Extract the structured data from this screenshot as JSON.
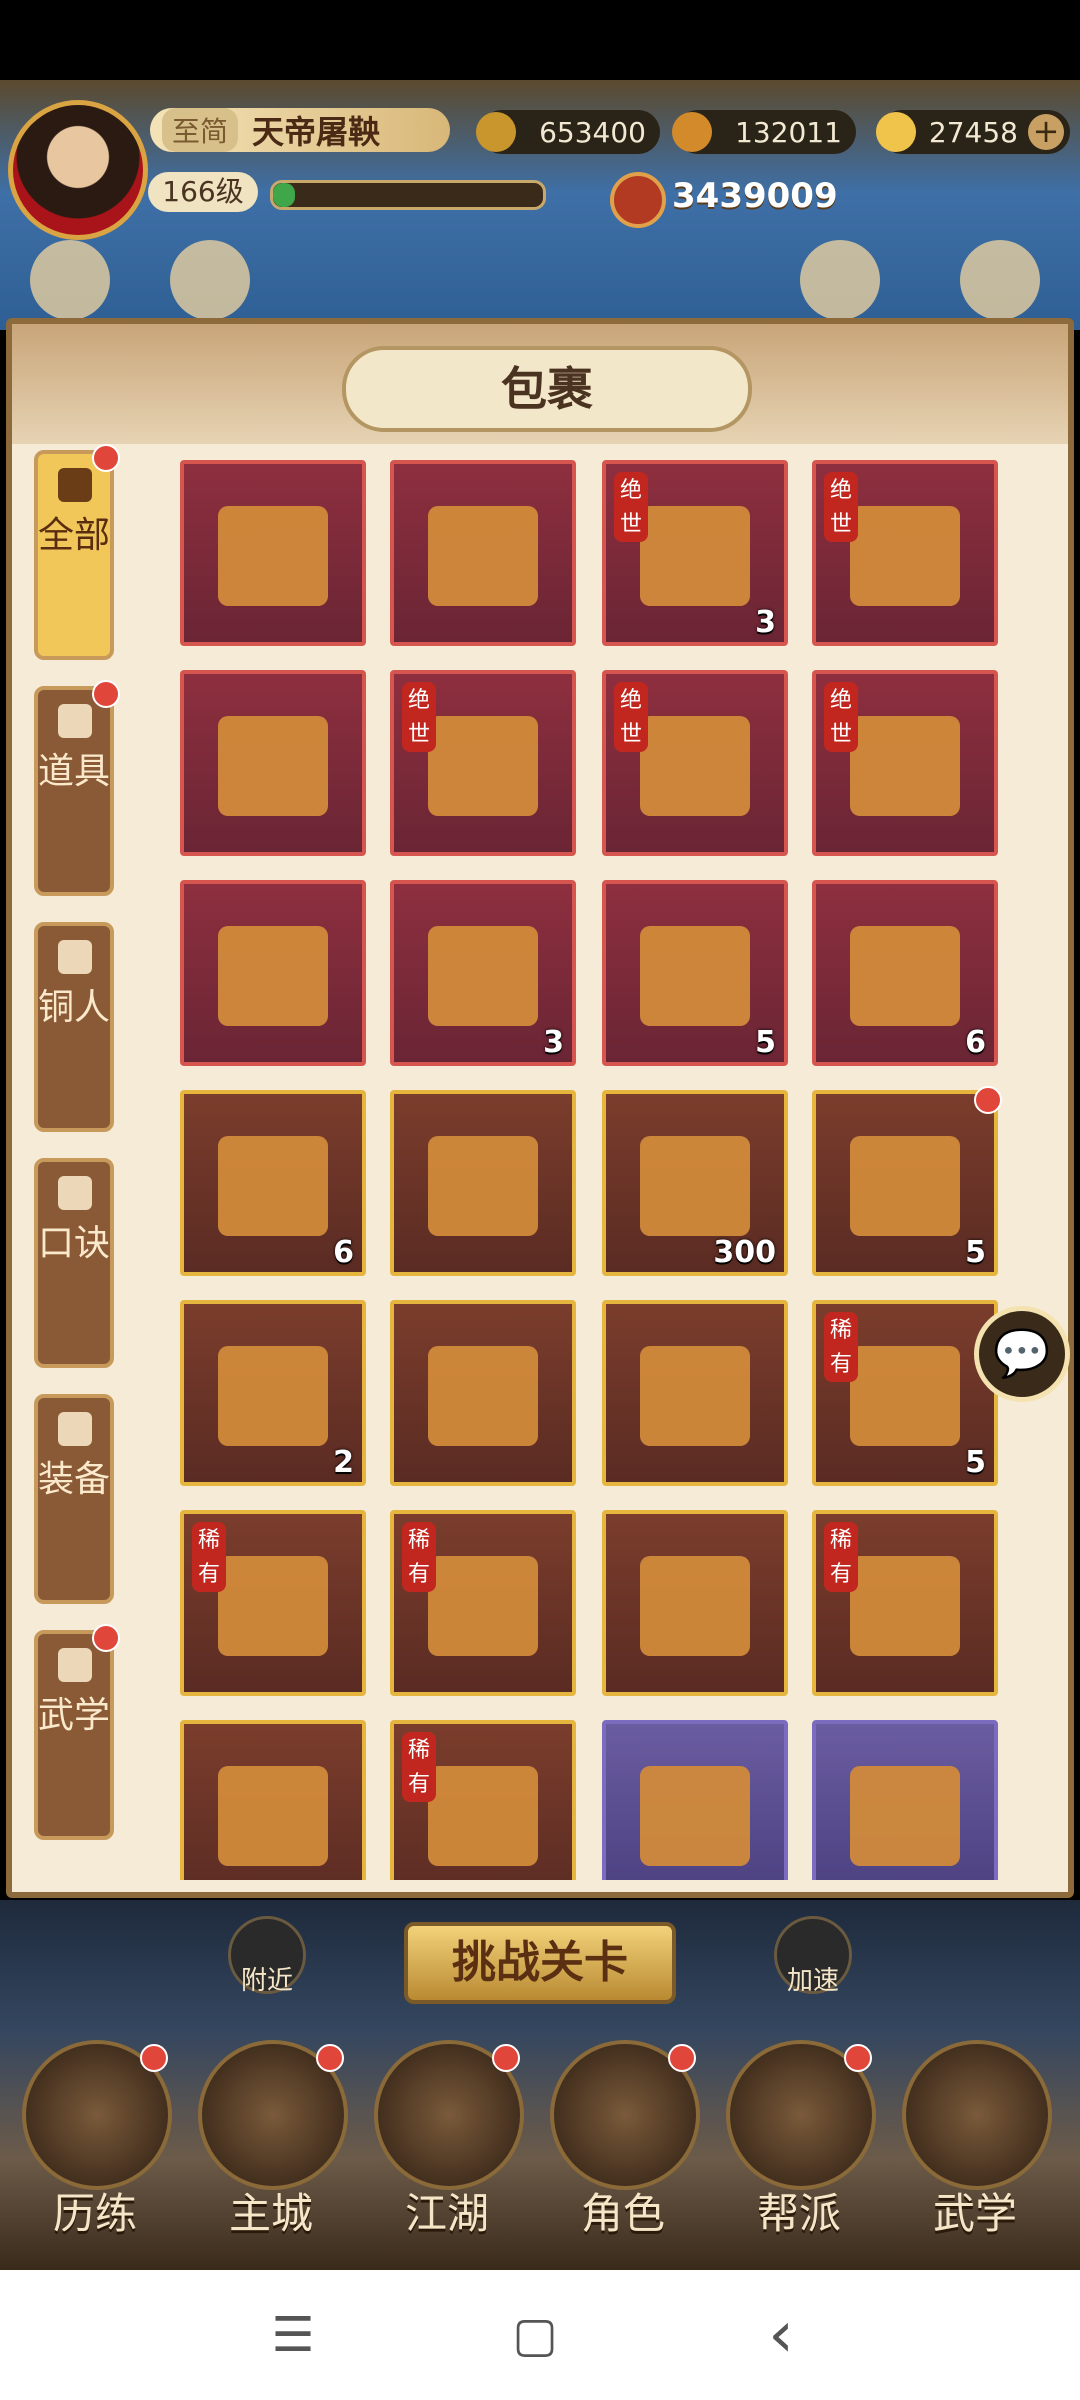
{
  "player": {
    "vip_tag": "至简",
    "name": "天帝屠鞅",
    "level": "166级",
    "power": "3439009",
    "exp_progress": 0.08
  },
  "resources": {
    "coins": "653400",
    "ingots": "132011",
    "gold": "27458",
    "add_label": "+"
  },
  "panel": {
    "title": "包裹"
  },
  "tabs": [
    {
      "label": "全部",
      "has_dot": true,
      "active": true,
      "icon": "fan-icon"
    },
    {
      "label": "道具",
      "has_dot": true,
      "active": false,
      "icon": "bag-icon"
    },
    {
      "label": "铜人",
      "has_dot": false,
      "active": false,
      "icon": "bronze-man-icon"
    },
    {
      "label": "口诀",
      "has_dot": false,
      "active": false,
      "icon": "scroll-icon"
    },
    {
      "label": "装备",
      "has_dot": false,
      "active": false,
      "icon": "armor-icon"
    },
    {
      "label": "武学",
      "has_dot": true,
      "active": false,
      "icon": "book-icon"
    }
  ],
  "items": [
    {
      "rarity": "red",
      "icon": "red-envelope-icon",
      "count": "",
      "tag": ""
    },
    {
      "rarity": "red",
      "icon": "weapon-chest-icon",
      "count": "",
      "tag": ""
    },
    {
      "rarity": "red",
      "icon": "manual-chest-icon",
      "count": "3",
      "tag": "绝世"
    },
    {
      "rarity": "red",
      "icon": "token-chest-icon",
      "count": "",
      "tag": "绝世"
    },
    {
      "rarity": "red",
      "icon": "gender-orb-icon",
      "count": "",
      "tag": ""
    },
    {
      "rarity": "red",
      "icon": "token-chest-icon",
      "count": "",
      "tag": "绝世"
    },
    {
      "rarity": "red",
      "icon": "token-chest-icon",
      "count": "",
      "tag": "绝世"
    },
    {
      "rarity": "red",
      "icon": "token-chest-icon",
      "count": "",
      "tag": "绝世"
    },
    {
      "rarity": "red",
      "icon": "horse-scroll-icon",
      "count": "",
      "tag": ""
    },
    {
      "rarity": "red",
      "icon": "gem-tray-icon",
      "count": "3",
      "tag": ""
    },
    {
      "rarity": "red",
      "icon": "weapon-chest-icon",
      "count": "5",
      "tag": ""
    },
    {
      "rarity": "red",
      "icon": "green-gem-chest-icon",
      "count": "6",
      "tag": ""
    },
    {
      "rarity": "gold",
      "icon": "jade-needles-icon",
      "count": "6",
      "tag": ""
    },
    {
      "rarity": "gold",
      "icon": "ore-chest-icon",
      "count": "",
      "tag": ""
    },
    {
      "rarity": "gold",
      "icon": "manual-box-icon",
      "count": "300",
      "tag": ""
    },
    {
      "rarity": "gold",
      "icon": "red-manual-icon",
      "count": "5",
      "tag": "",
      "has_dot": true
    },
    {
      "rarity": "gold",
      "icon": "manual-chest-icon",
      "count": "2",
      "tag": ""
    },
    {
      "rarity": "gold",
      "icon": "manual-chest-icon",
      "count": "",
      "tag": ""
    },
    {
      "rarity": "gold",
      "icon": "manual-chest-icon",
      "count": "",
      "tag": ""
    },
    {
      "rarity": "gold",
      "icon": "manual-chest-icon",
      "count": "5",
      "tag": "稀有"
    },
    {
      "rarity": "gold",
      "icon": "token-chest-icon",
      "count": "",
      "tag": "稀有"
    },
    {
      "rarity": "gold",
      "icon": "token-chest-icon",
      "count": "",
      "tag": "稀有"
    },
    {
      "rarity": "gold",
      "icon": "black-token-chest-icon",
      "count": "",
      "tag": ""
    },
    {
      "rarity": "gold",
      "icon": "token-chest-icon",
      "count": "",
      "tag": "稀有"
    },
    {
      "rarity": "gold",
      "icon": "black-token-chest-icon",
      "count": "",
      "tag": ""
    },
    {
      "rarity": "gold",
      "icon": "token-chest-icon",
      "count": "",
      "tag": "稀有"
    },
    {
      "rarity": "purple",
      "icon": "silver-needles-icon",
      "count": "",
      "tag": ""
    },
    {
      "rarity": "purple",
      "icon": "ore-tray-icon",
      "count": "",
      "tag": ""
    }
  ],
  "bottom": {
    "nearby": "附近",
    "challenge": "挑战关卡",
    "speedup": "加速"
  },
  "nav": [
    {
      "label": "历练",
      "icon": "training-icon"
    },
    {
      "label": "主城",
      "icon": "city-icon"
    },
    {
      "label": "江湖",
      "icon": "jianghu-icon"
    },
    {
      "label": "角色",
      "icon": "character-icon"
    },
    {
      "label": "帮派",
      "icon": "guild-icon"
    },
    {
      "label": "武学",
      "icon": "martial-arts-icon"
    }
  ],
  "system_nav": {
    "menu": "☰",
    "home": "▢",
    "back": "‹"
  }
}
